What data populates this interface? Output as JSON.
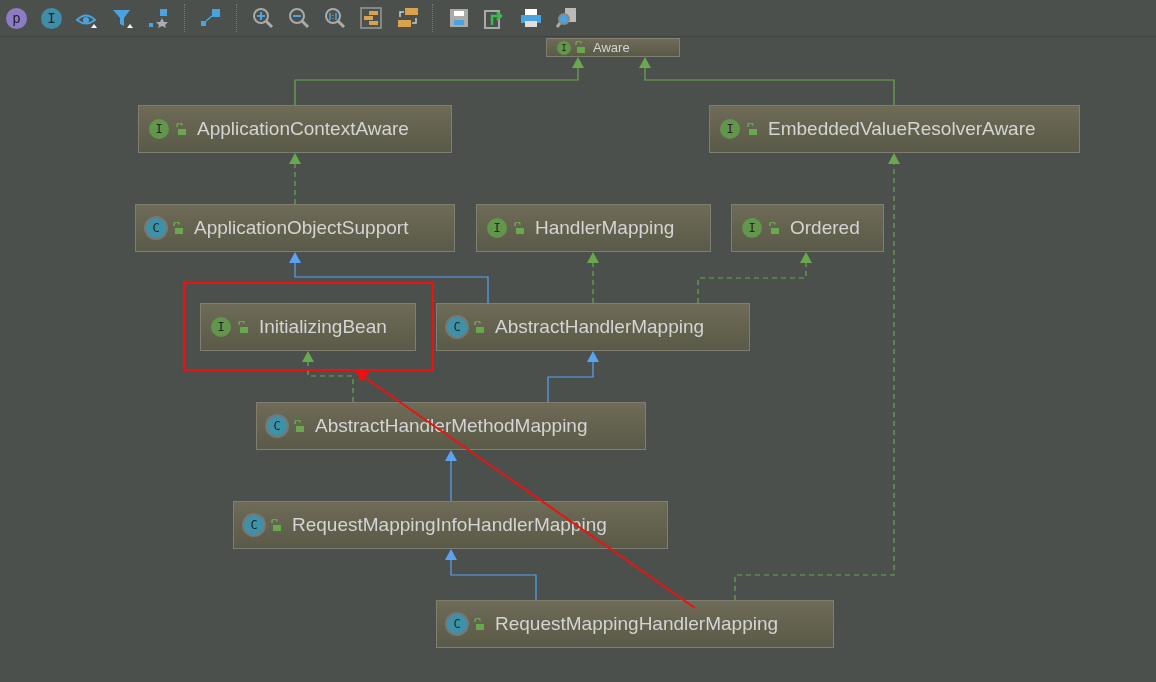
{
  "toolbar": {
    "letter_buttons": [
      {
        "letter": "p",
        "color": "#8e7cc3"
      },
      {
        "letter": "I",
        "color": "#3d8fa8"
      }
    ]
  },
  "diagram": {
    "nodes": [
      {
        "name": "Aware",
        "kind": "interface",
        "badge": "I"
      },
      {
        "name": "ApplicationContextAware",
        "kind": "interface",
        "badge": "I"
      },
      {
        "name": "EmbeddedValueResolverAware",
        "kind": "interface",
        "badge": "I"
      },
      {
        "name": "ApplicationObjectSupport",
        "kind": "class",
        "badge": "C"
      },
      {
        "name": "HandlerMapping",
        "kind": "interface",
        "badge": "I"
      },
      {
        "name": "Ordered",
        "kind": "interface",
        "badge": "I"
      },
      {
        "name": "InitializingBean",
        "kind": "interface",
        "badge": "I"
      },
      {
        "name": "AbstractHandlerMapping",
        "kind": "class",
        "badge": "C"
      },
      {
        "name": "AbstractHandlerMethodMapping",
        "kind": "class",
        "badge": "C"
      },
      {
        "name": "RequestMappingInfoHandlerMapping",
        "kind": "class",
        "badge": "C"
      },
      {
        "name": "RequestMappingHandlerMapping",
        "kind": "class",
        "badge": "C"
      }
    ]
  }
}
